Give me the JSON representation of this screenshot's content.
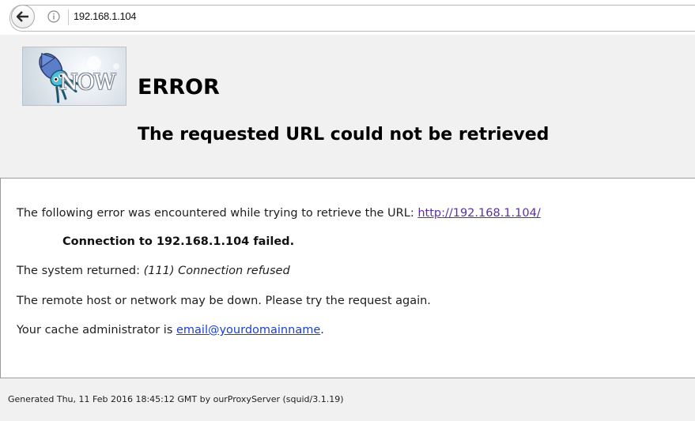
{
  "browser": {
    "url": "192.168.1.104",
    "icons": {
      "back": "back-arrow-icon",
      "info": "info-icon"
    }
  },
  "header": {
    "logo_text": "NOW",
    "title": "ERROR",
    "subtitle": "The requested URL could not be retrieved"
  },
  "content": {
    "line1_prefix": "The following error was encountered while trying to retrieve the URL: ",
    "line1_link": "http://192.168.1.104/",
    "line2": "Connection to 192.168.1.104 failed.",
    "line3_prefix": "The system returned: ",
    "line3_detail": "(111) Connection refused",
    "line4": "The remote host or network may be down. Please try the request again.",
    "line5_prefix": "Your cache administrator is ",
    "line5_email": "email@yourdomainname",
    "line5_suffix": "."
  },
  "footer": {
    "text": "Generated Thu, 11 Feb 2016 18:45:12 GMT by ourProxyServer (squid/3.1.19)"
  },
  "colors": {
    "header_bg": "#f1f1f1",
    "link_visited": "#5a2ea6",
    "link": "#1a3fd1"
  }
}
